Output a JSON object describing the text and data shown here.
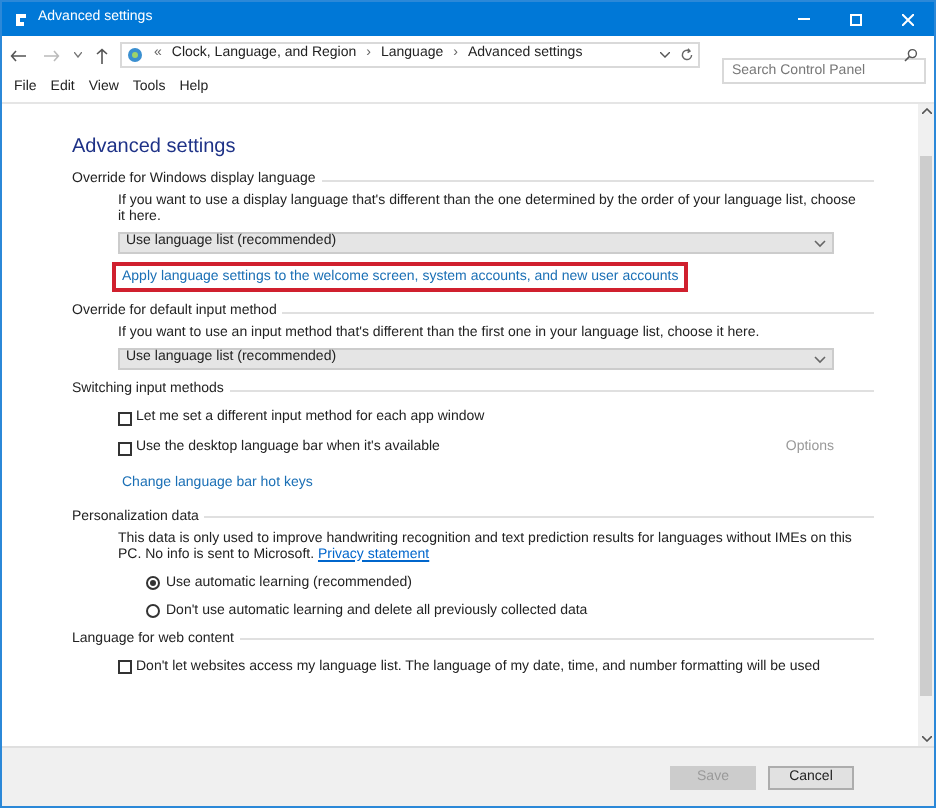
{
  "window": {
    "title": "Advanced settings"
  },
  "address": {
    "overflow": "«",
    "separator": "›",
    "breadcrumbs": [
      "Clock, Language, and Region",
      "Language",
      "Advanced settings"
    ],
    "search": {
      "placeholder": "Search Control Panel"
    }
  },
  "menu": [
    "File",
    "Edit",
    "View",
    "Tools",
    "Help"
  ],
  "heading": "Advanced settings",
  "sections": [
    {
      "title": "Override for Windows display language",
      "items": [
        {
          "kind": "text",
          "text": "If you want to use a display language that's different than the one determined by the order of your language list, choose it here."
        },
        {
          "kind": "dropdown",
          "text": "Use language list (recommended)"
        },
        {
          "kind": "link",
          "text": "Apply language settings to the welcome screen, system accounts, and new user accounts",
          "highlighted": true
        }
      ]
    },
    {
      "title": "Override for default input method",
      "items": [
        {
          "kind": "text",
          "text": "If you want to use an input method that's different than the first one in your language list, choose it here."
        },
        {
          "kind": "dropdown",
          "text": "Use language list (recommended)"
        }
      ]
    },
    {
      "title": "Switching input methods",
      "items": [
        {
          "kind": "checkbox",
          "text": "Let me set a different input method for each app window",
          "checked": false
        },
        {
          "kind": "checkbox",
          "text": "Use the desktop language bar when it's available",
          "checked": false,
          "aside": "Options"
        },
        {
          "kind": "link",
          "text": "Change language bar hot keys",
          "highlighted": false
        }
      ]
    },
    {
      "title": "Personalization data",
      "items": [
        {
          "kind": "text",
          "text": "This data is only used to improve handwriting recognition and text prediction results for languages without IMEs on this PC. No info is sent to Microsoft. ",
          "link": "Privacy statement"
        },
        {
          "kind": "radio",
          "text": "Use automatic learning (recommended)",
          "selected": true
        },
        {
          "kind": "radio",
          "text": "Don't use automatic learning and delete all previously collected data",
          "selected": false
        }
      ]
    },
    {
      "title": "Language for web content",
      "items": [
        {
          "kind": "checkbox",
          "text": "Don't let websites access my language list. The language of my date, time, and number formatting will be used",
          "checked": false
        }
      ]
    }
  ],
  "buttons": [
    {
      "label": "Save",
      "disabled": true
    },
    {
      "label": "Cancel",
      "disabled": false
    }
  ]
}
